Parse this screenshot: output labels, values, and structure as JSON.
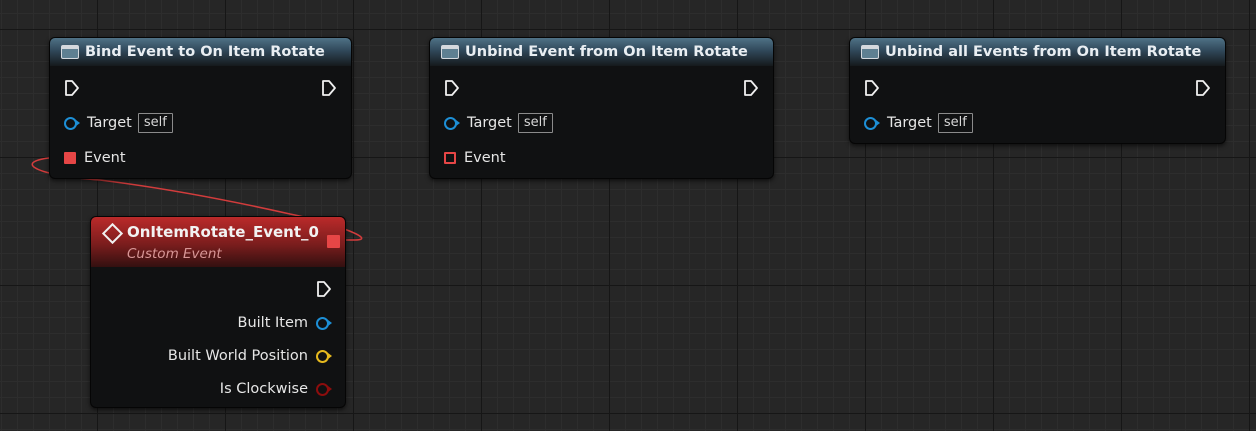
{
  "nodes": {
    "bind": {
      "title": "Bind Event to On Item Rotate",
      "target_label": "Target",
      "target_value": "self",
      "event_label": "Event"
    },
    "unbind": {
      "title": "Unbind Event from On Item Rotate",
      "target_label": "Target",
      "target_value": "self",
      "event_label": "Event"
    },
    "unbind_all": {
      "title": "Unbind all Events from On Item Rotate",
      "target_label": "Target",
      "target_value": "self"
    },
    "custom_event": {
      "title": "OnItemRotate_Event_0",
      "subtitle": "Custom Event",
      "outputs": [
        {
          "label": "Built Item",
          "color": "#1d8fd6"
        },
        {
          "label": "Built World Position",
          "color": "#e6b91e"
        },
        {
          "label": "Is Clockwise",
          "color": "#8c0d0d"
        }
      ]
    }
  },
  "colors": {
    "object_pin": "#1d8fd6",
    "delegate_pin": "#e64646",
    "vector_pin": "#e6b91e",
    "bool_pin": "#8c0d0d",
    "wire": "#d23c3c"
  }
}
